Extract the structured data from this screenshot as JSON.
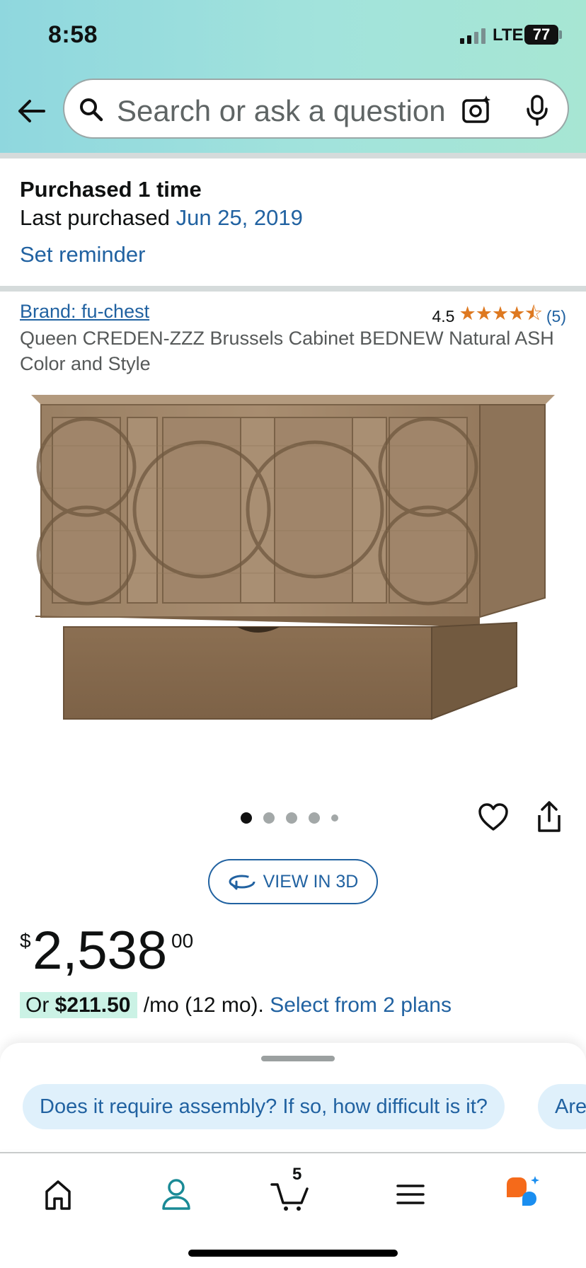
{
  "status_bar": {
    "time": "8:58",
    "network": "LTE",
    "battery": "77"
  },
  "search": {
    "placeholder": "Search or ask a question"
  },
  "purchase_history": {
    "purchased_label": "Purchased 1 time",
    "last_purchased_label": "Last purchased",
    "last_purchased_date": "Jun 25, 2019",
    "set_reminder": "Set reminder"
  },
  "product": {
    "brand": "Brand: fu-chest",
    "rating_value": "4.5",
    "stars": "★★★★⯪",
    "rating_count": "(5)",
    "title": "Queen CREDEN-ZZZ Brussels Cabinet BEDNEW Natural ASH Color and Style",
    "image_page": {
      "total_dots": 5,
      "active": 1
    },
    "view_3d_label": "VIEW IN 3D",
    "price": {
      "symbol": "$",
      "whole": "2,538",
      "fraction": "00"
    },
    "financing": {
      "prefix": "Or ",
      "monthly": "$211.50",
      "term": " /mo (12 mo). ",
      "plans_link": "Select from 2 plans"
    }
  },
  "suggestions": [
    "Does it require assembly? If so, how difficult is it?",
    "Are"
  ],
  "bottom_nav": {
    "cart_count": "5"
  },
  "colors": {
    "link": "#2162a1",
    "star": "#de7921",
    "financing_badge": "#cbf2e5",
    "header_gradient_start": "#8fd7de",
    "header_gradient_end": "#a7e6d3",
    "account_icon": "#1a8a96",
    "rufus_orange": "#f56a1a",
    "rufus_blue": "#1a8ef0"
  },
  "icons": [
    "back-arrow-icon",
    "search-icon",
    "camera-icon",
    "mic-icon",
    "heart-icon",
    "share-icon",
    "rotate-3d-icon",
    "home-icon",
    "account-icon",
    "cart-icon",
    "menu-icon",
    "rufus-icon"
  ]
}
